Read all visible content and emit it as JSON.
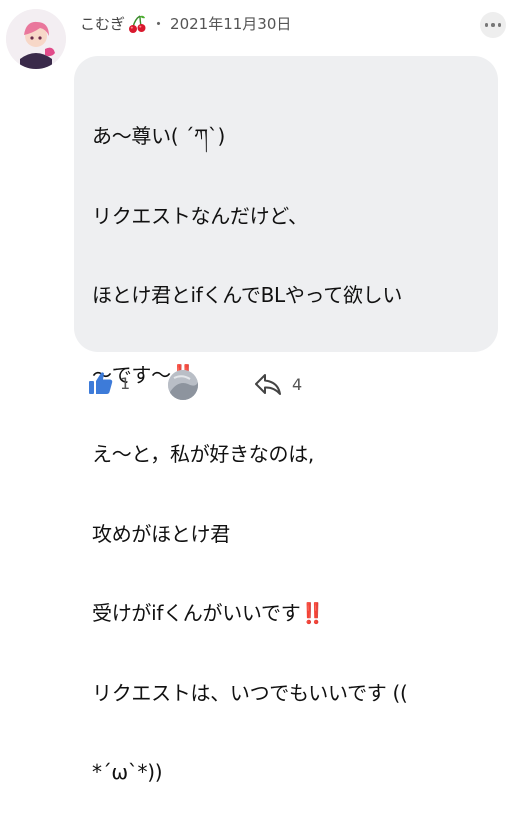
{
  "post": {
    "author": "こむぎ",
    "separator": "・",
    "date": "2021年11月30日",
    "lines": [
      {
        "text": "あ〜尊い( ´ཀ`)",
        "bang": ""
      },
      {
        "text": "リクエストなんだけど、",
        "bang": ""
      },
      {
        "text": "ほとけ君とifくんでBLやって欲しい",
        "bang": ""
      },
      {
        "text": "〜です〜",
        "bang": "‼️"
      },
      {
        "text": "え〜と，私が好きなのは,",
        "bang": ""
      },
      {
        "text": "攻めがほとけ君",
        "bang": ""
      },
      {
        "text": "受けがifくんがいいです",
        "bang": "‼️"
      },
      {
        "text": "リクエストは、いつでもいいです ((",
        "bang": ""
      },
      {
        "text": "*´ω`*))",
        "bang": ""
      }
    ]
  },
  "actions": {
    "like_count": "1",
    "reply_count": "4"
  },
  "colors": {
    "like_blue": "#3d7bd9",
    "bubble_bg": "#eeeff1",
    "exclaim_red": "#e0152a"
  },
  "icons": {
    "author_badge": "cherry-icon",
    "menu": "more-options-icon",
    "like": "thumbs-up-icon",
    "reply": "reply-arrow-icon"
  }
}
